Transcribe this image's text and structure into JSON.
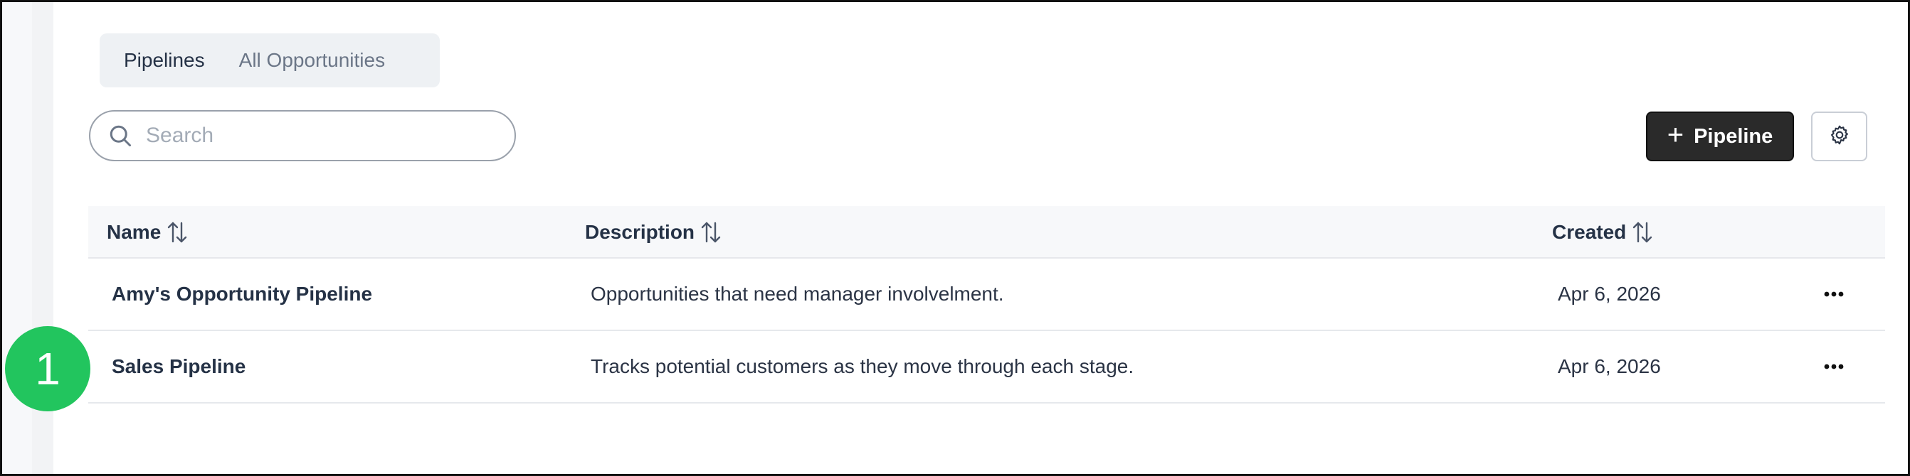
{
  "tabs": [
    {
      "label": "Pipelines",
      "active": true
    },
    {
      "label": "All Opportunities",
      "active": false
    }
  ],
  "search": {
    "placeholder": "Search",
    "value": ""
  },
  "toolbar": {
    "add_pipeline_label": "Pipeline",
    "add_icon": "plus-icon",
    "settings_icon": "gear-icon"
  },
  "table": {
    "headers": {
      "name": "Name",
      "description": "Description",
      "created": "Created"
    },
    "rows": [
      {
        "name": "Amy's Opportunity Pipeline",
        "description": "Opportunities that need manager involvelment.",
        "created": "Apr 6, 2026"
      },
      {
        "name": "Sales Pipeline",
        "description": "Tracks potential customers as they move through each stage.",
        "created": "Apr 6, 2026"
      }
    ]
  },
  "badge": {
    "number": "1",
    "color": "#22c55e"
  },
  "colors": {
    "primary_button": "#2a2a2a",
    "accent_green": "#22c55e"
  }
}
